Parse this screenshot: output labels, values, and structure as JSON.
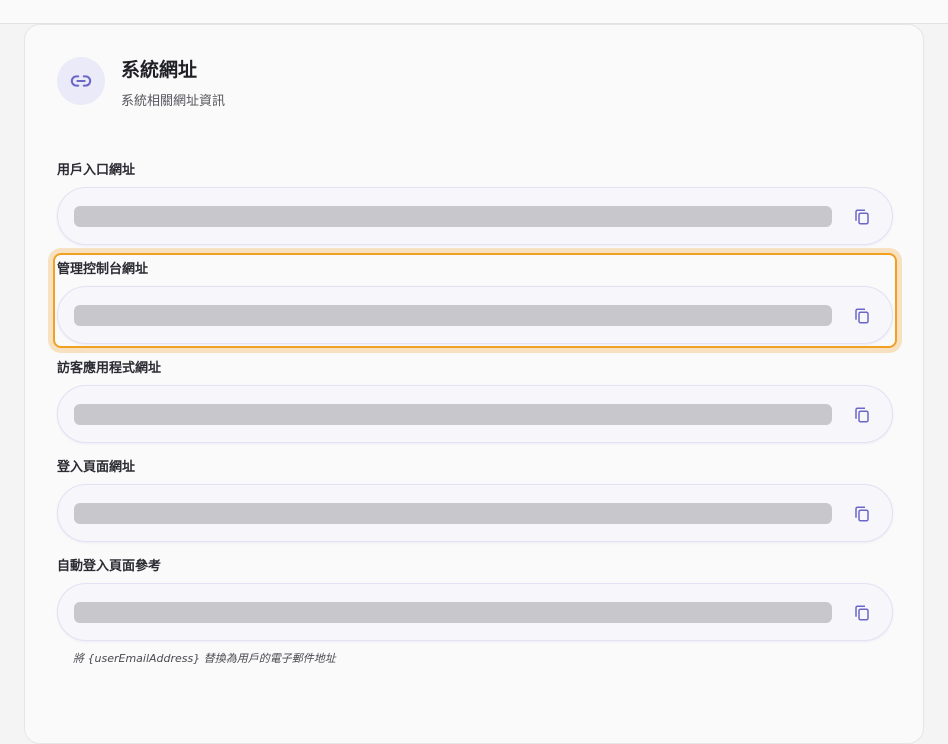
{
  "header": {
    "icon": "link-icon",
    "title": "系統網址",
    "subtitle": "系統相關網址資訊"
  },
  "fields": [
    {
      "label": "用戶入口網址",
      "value": "",
      "copy_icon": "copy-icon"
    },
    {
      "label": "管理控制台網址",
      "value": "",
      "copy_icon": "copy-icon",
      "highlighted": true
    },
    {
      "label": "訪客應用程式網址",
      "value": "",
      "copy_icon": "copy-icon"
    },
    {
      "label": "登入頁面網址",
      "value": "",
      "copy_icon": "copy-icon"
    },
    {
      "label": "自動登入頁面參考",
      "value": "",
      "copy_icon": "copy-icon"
    }
  ],
  "hint": "將 {userEmailAddress} 替換為用戶的電子郵件地址",
  "colors": {
    "accent": "#6b67c9",
    "highlight": "#f0a023",
    "placeholder_bar": "#c8c8cc"
  }
}
